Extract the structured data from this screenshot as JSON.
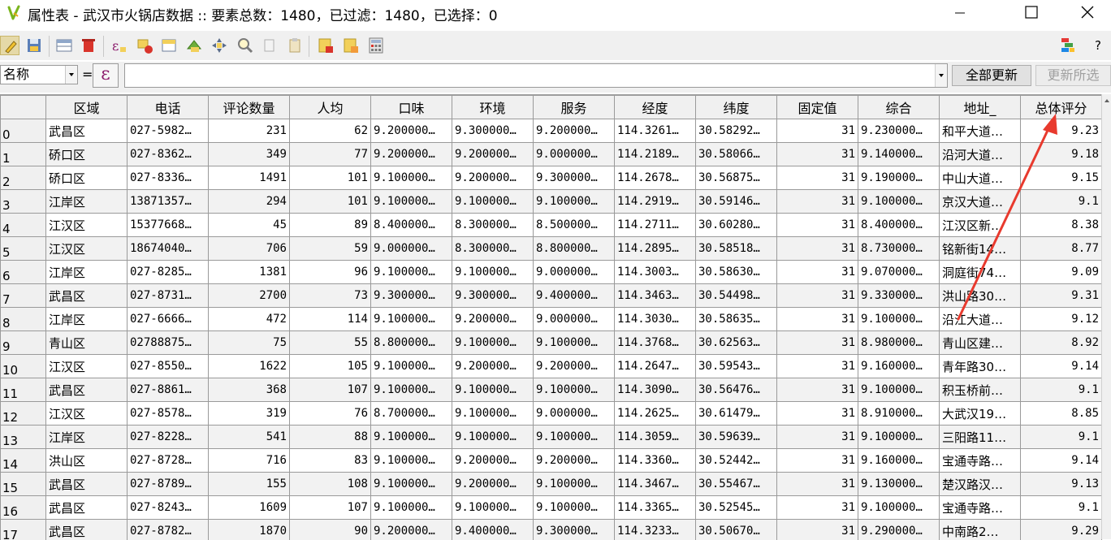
{
  "window": {
    "title": "属性表 - 武汉市火锅店数据 :: 要素总数：1480，已过滤：1480，已选择：0",
    "controls": [
      "minimize-icon",
      "maximize-icon",
      "close-icon"
    ]
  },
  "toolbar": {
    "icons": [
      "edit-pencil-icon",
      "save-edits-icon",
      "add-feature-icon",
      "delete-feature-icon",
      "select-by-expression-icon",
      "deselect-all-icon",
      "move-selection-to-top-icon",
      "invert-selection-icon",
      "pan-to-selection-icon",
      "zoom-to-selection-icon",
      "copy-rows-icon",
      "paste-rows-icon",
      "delete-field-icon",
      "new-field-icon",
      "field-calculator-icon"
    ],
    "right_icons": [
      "dock-icon",
      "help-icon"
    ],
    "help_label": "?"
  },
  "filter": {
    "field_value": "名称",
    "equals": "=",
    "expression_symbol": "ε",
    "expression_value": "",
    "update_all_label": "全部更新",
    "update_selected_label": "更新所选"
  },
  "table": {
    "columns": [
      "区域",
      "电话",
      "评论数量",
      "人均",
      "口味",
      "环境",
      "服务",
      "经度",
      "纬度",
      "固定值",
      "综合",
      "地址_",
      "总体评分"
    ],
    "rows": [
      {
        "id": "0",
        "cells": [
          "武昌区",
          "027-5982…",
          "231",
          "62",
          "9.200000…",
          "9.300000…",
          "9.200000…",
          "114.3261…",
          "30.58292…",
          "31",
          "9.230000…",
          "和平大道…",
          "9.23"
        ]
      },
      {
        "id": "1",
        "cells": [
          "硚口区",
          "027-8362…",
          "349",
          "77",
          "9.200000…",
          "9.200000…",
          "9.000000…",
          "114.2189…",
          "30.58066…",
          "31",
          "9.140000…",
          "沿河大道…",
          "9.18"
        ]
      },
      {
        "id": "2",
        "cells": [
          "硚口区",
          "027-8336…",
          "1491",
          "101",
          "9.100000…",
          "9.200000…",
          "9.300000…",
          "114.2678…",
          "30.56875…",
          "31",
          "9.190000…",
          "中山大道…",
          "9.15"
        ]
      },
      {
        "id": "3",
        "cells": [
          "江岸区",
          "13871357…",
          "294",
          "101",
          "9.100000…",
          "9.100000…",
          "9.100000…",
          "114.2919…",
          "30.59146…",
          "31",
          "9.100000…",
          "京汉大道…",
          "9.1"
        ]
      },
      {
        "id": "4",
        "cells": [
          "江汉区",
          "15377668…",
          "45",
          "89",
          "8.400000…",
          "8.300000…",
          "8.500000…",
          "114.2711…",
          "30.60280…",
          "31",
          "8.400000…",
          "江汉区新…",
          "8.38"
        ]
      },
      {
        "id": "5",
        "cells": [
          "江汉区",
          "18674040…",
          "706",
          "59",
          "9.000000…",
          "8.300000…",
          "8.800000…",
          "114.2895…",
          "30.58518…",
          "31",
          "8.730000…",
          "铭新街14…",
          "8.77"
        ]
      },
      {
        "id": "6",
        "cells": [
          "江岸区",
          "027-8285…",
          "1381",
          "96",
          "9.100000…",
          "9.100000…",
          "9.000000…",
          "114.3003…",
          "30.58630…",
          "31",
          "9.070000…",
          "洞庭街74…",
          "9.09"
        ]
      },
      {
        "id": "7",
        "cells": [
          "武昌区",
          "027-8731…",
          "2700",
          "73",
          "9.300000…",
          "9.300000…",
          "9.400000…",
          "114.3463…",
          "30.54498…",
          "31",
          "9.330000…",
          "洪山路30…",
          "9.31"
        ]
      },
      {
        "id": "8",
        "cells": [
          "江岸区",
          "027-6666…",
          "472",
          "114",
          "9.100000…",
          "9.200000…",
          "9.000000…",
          "114.3030…",
          "30.58635…",
          "31",
          "9.100000…",
          "沿江大道…",
          "9.12"
        ]
      },
      {
        "id": "9",
        "cells": [
          "青山区",
          "02788875…",
          "75",
          "55",
          "8.800000…",
          "9.100000…",
          "9.100000…",
          "114.3768…",
          "30.62563…",
          "31",
          "8.980000…",
          "青山区建…",
          "8.92"
        ]
      },
      {
        "id": "10",
        "cells": [
          "江汉区",
          "027-8550…",
          "1622",
          "105",
          "9.100000…",
          "9.200000…",
          "9.200000…",
          "114.2647…",
          "30.59543…",
          "31",
          "9.160000…",
          "青年路30…",
          "9.14"
        ]
      },
      {
        "id": "11",
        "cells": [
          "武昌区",
          "027-8861…",
          "368",
          "107",
          "9.100000…",
          "9.100000…",
          "9.100000…",
          "114.3090…",
          "30.56476…",
          "31",
          "9.100000…",
          "积玉桥前…",
          "9.1"
        ]
      },
      {
        "id": "12",
        "cells": [
          "江汉区",
          "027-8578…",
          "319",
          "76",
          "8.700000…",
          "9.100000…",
          "9.000000…",
          "114.2625…",
          "30.61479…",
          "31",
          "8.910000…",
          "大武汉19…",
          "8.85"
        ]
      },
      {
        "id": "13",
        "cells": [
          "江岸区",
          "027-8228…",
          "541",
          "88",
          "9.100000…",
          "9.100000…",
          "9.100000…",
          "114.3059…",
          "30.59639…",
          "31",
          "9.100000…",
          "三阳路11…",
          "9.1"
        ]
      },
      {
        "id": "14",
        "cells": [
          "洪山区",
          "027-8728…",
          "716",
          "83",
          "9.100000…",
          "9.200000…",
          "9.200000…",
          "114.3360…",
          "30.52442…",
          "31",
          "9.160000…",
          "宝通寺路…",
          "9.14"
        ]
      },
      {
        "id": "15",
        "cells": [
          "武昌区",
          "027-8789…",
          "155",
          "108",
          "9.100000…",
          "9.200000…",
          "9.100000…",
          "114.3467…",
          "30.55467…",
          "31",
          "9.130000…",
          "楚汉路汉…",
          "9.13"
        ]
      },
      {
        "id": "16",
        "cells": [
          "武昌区",
          "027-8243…",
          "1609",
          "107",
          "9.100000…",
          "9.100000…",
          "9.100000…",
          "114.3365…",
          "30.52545…",
          "31",
          "9.100000…",
          "宝通寺路…",
          "9.1"
        ]
      },
      {
        "id": "17",
        "cells": [
          "武昌区",
          "027-8782…",
          "1870",
          "90",
          "9.200000…",
          "9.400000…",
          "9.300000…",
          "114.3233…",
          "30.50670…",
          "31",
          "9.290000…",
          "中南路2…",
          "9.29"
        ]
      }
    ]
  },
  "annotation": {
    "color": "#e83a2e"
  }
}
